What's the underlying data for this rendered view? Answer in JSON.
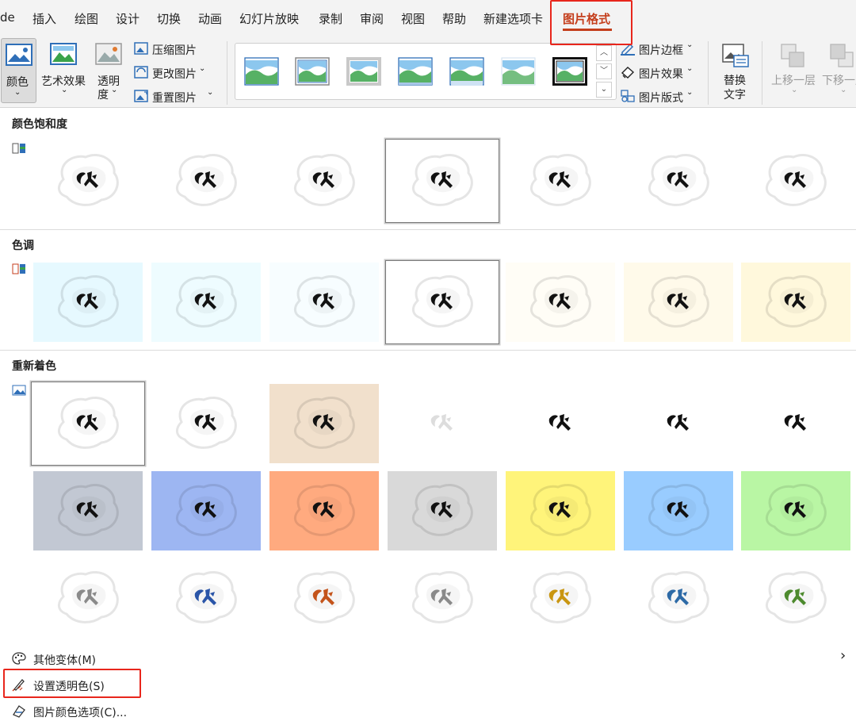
{
  "tabs": {
    "items": [
      "de",
      "插入",
      "绘图",
      "设计",
      "切换",
      "动画",
      "幻灯片放映",
      "录制",
      "审阅",
      "视图",
      "帮助",
      "新建选项卡"
    ],
    "active": "图片格式"
  },
  "ribbon": {
    "color": "颜色",
    "art_effects": "艺术效果",
    "transparency_1": "透明",
    "transparency_2": "度",
    "compress": "压缩图片",
    "change": "更改图片",
    "reset": "重置图片",
    "border": "图片边框",
    "effects": "图片效果",
    "layout": "图片版式",
    "alt_text_1": "替换",
    "alt_text_2": "文字",
    "bring_forward": "上移一层",
    "send_backward": "下移一层"
  },
  "panel": {
    "saturation_title": "颜色饱和度",
    "tone_title": "色调",
    "recolor_title": "重新着色",
    "saturation_bg": [
      "#ffffff",
      "#ffffff",
      "#ffffff",
      "#ffffff",
      "#ffffff",
      "#ffffff",
      "#ffffff"
    ],
    "saturation_selected": 3,
    "tone_bg": [
      "#e6f9ff",
      "#eefcff",
      "#f7fdff",
      "#ffffff",
      "#fffdf6",
      "#fffaea",
      "#fff8dc"
    ],
    "tone_selected": 3,
    "recolor_row1_bg": [
      "#ffffff",
      "#ffffff",
      "#f1e0cc",
      "#ffffff",
      "#ffffff",
      "#ffffff",
      "#ffffff"
    ],
    "recolor_row1_fg": [
      "#111111",
      "#111111",
      "#111111",
      "#dddddd",
      "#111111",
      "#111111",
      "#111111"
    ],
    "recolor_row2_bg": [
      "#c2c8d3",
      "#9db6f2",
      "#ffaa7f",
      "#d9d9d9",
      "#fff47a",
      "#99ccff",
      "#b9f6a4"
    ],
    "recolor_row2_fg": [
      "#111111",
      "#111111",
      "#111111",
      "#111111",
      "#111111",
      "#111111",
      "#111111"
    ],
    "recolor_row3_bg": [
      "#ffffff",
      "#ffffff",
      "#ffffff",
      "#ffffff",
      "#ffffff",
      "#ffffff",
      "#ffffff"
    ],
    "recolor_row3_fg": [
      "#8a8a8a",
      "#2a55a8",
      "#c4541b",
      "#8a8a8a",
      "#c99611",
      "#2d6aa6",
      "#4d8a2e"
    ],
    "recolor_selected": 0
  },
  "menu": {
    "more_variants": "其他变体(M)",
    "set_transparent": "设置透明色(S)",
    "color_options": "图片颜色选项(C)...",
    "chevron": "›"
  },
  "colors": {
    "accent": "#c43e1c",
    "highlight": "#e8261c"
  }
}
